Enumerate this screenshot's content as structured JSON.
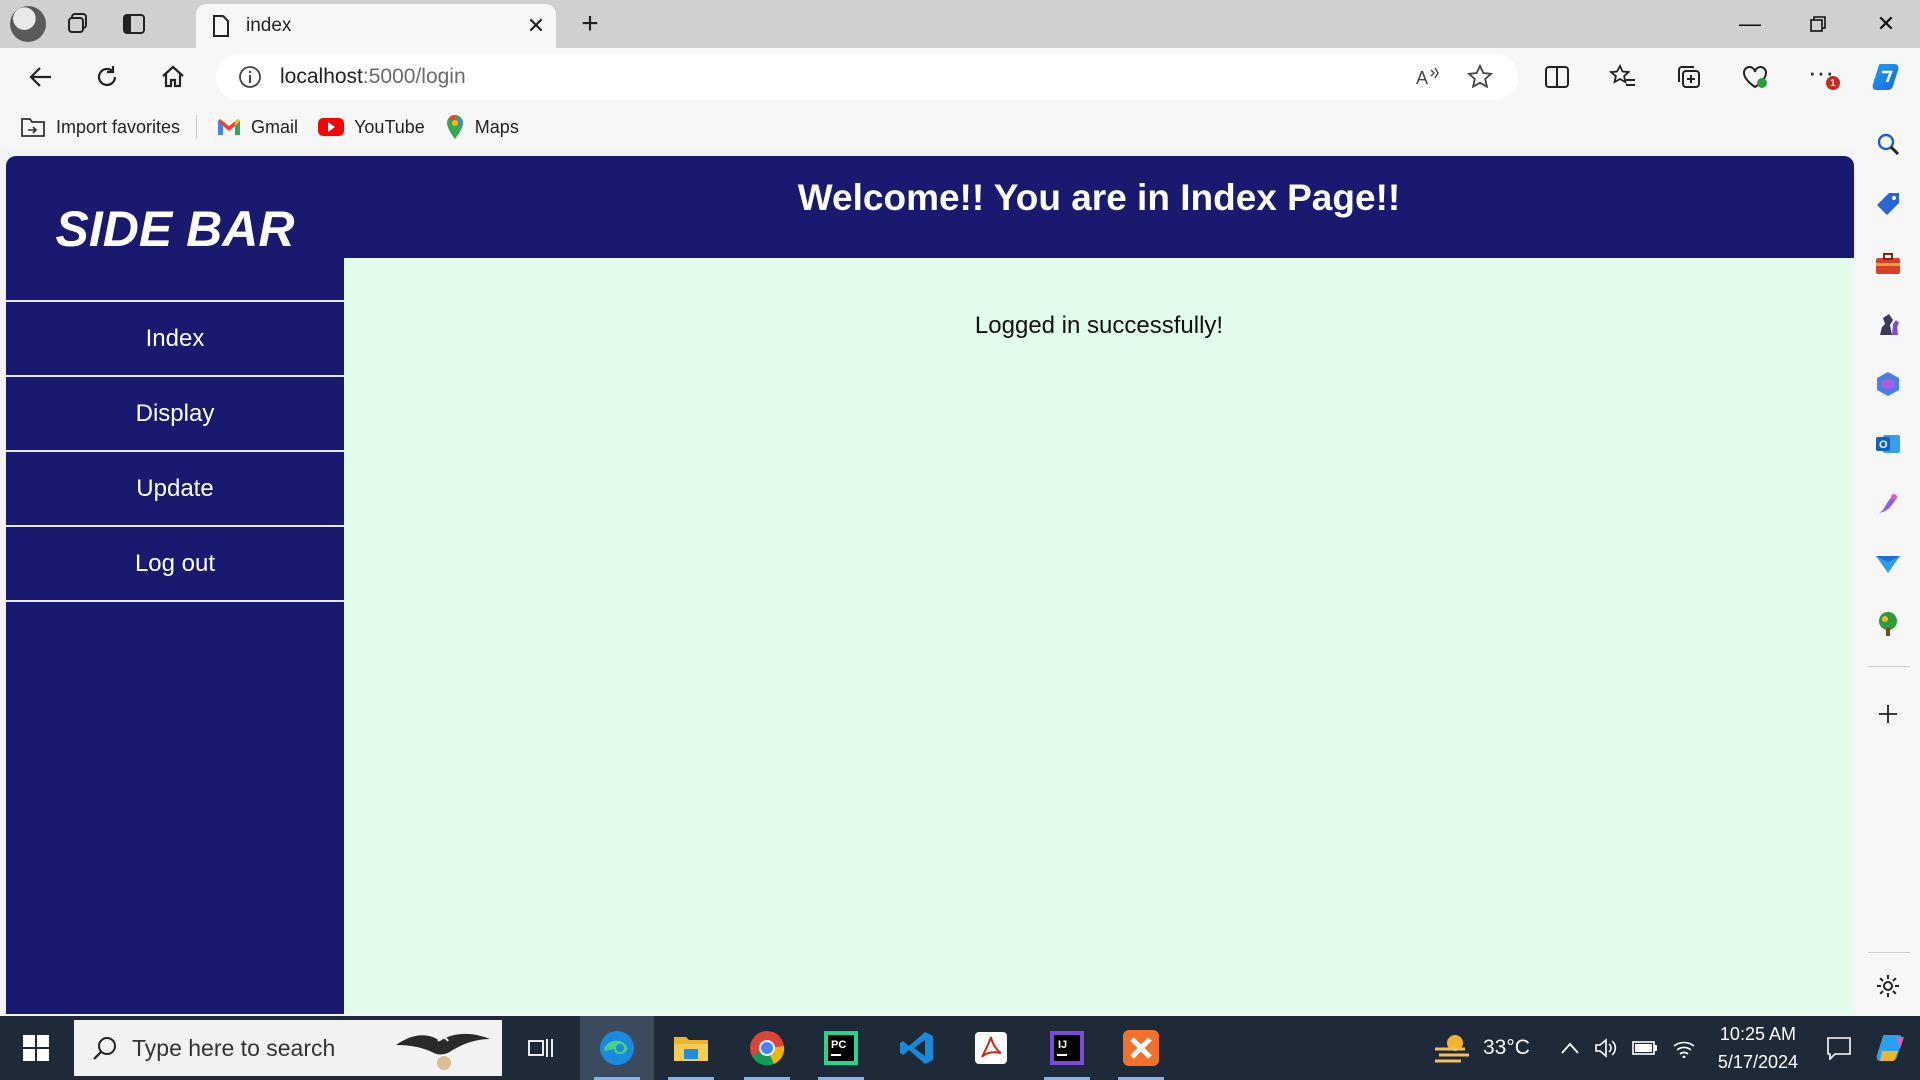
{
  "browser": {
    "tab_title": "index",
    "url_host": "localhost",
    "url_path": ":5000/login",
    "favorites": [
      {
        "label": "Import favorites",
        "icon": "import-favorites-icon"
      },
      {
        "label": "Gmail",
        "icon": "gmail-icon"
      },
      {
        "label": "YouTube",
        "icon": "youtube-icon"
      },
      {
        "label": "Maps",
        "icon": "maps-icon"
      }
    ],
    "notification_badge": "1"
  },
  "page": {
    "sidebar_title": "SIDE BAR",
    "nav": [
      {
        "label": "Index"
      },
      {
        "label": "Display"
      },
      {
        "label": "Update"
      },
      {
        "label": "Log out"
      }
    ],
    "header_title": "Welcome!! You are in Index Page!!",
    "message": "Logged in successfully!",
    "colors": {
      "sidebar": "#191970",
      "content_bg": "#e3fbea"
    }
  },
  "taskbar": {
    "search_placeholder": "Type here to search",
    "temperature": "33°C",
    "time": "10:25 AM",
    "date": "5/17/2024"
  }
}
